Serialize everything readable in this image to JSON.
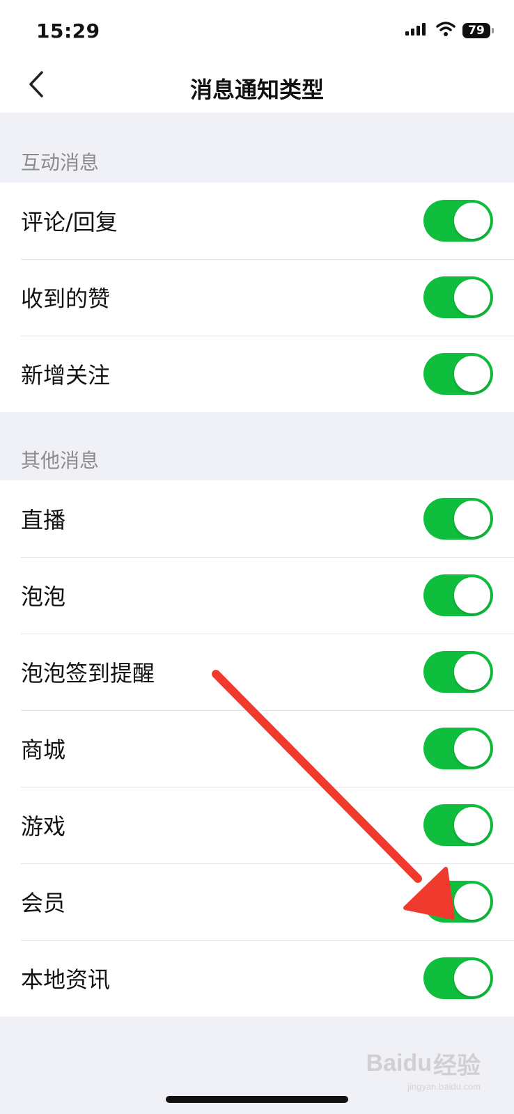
{
  "status_bar": {
    "time": "15:29",
    "battery": "79",
    "icons": [
      "signal-icon",
      "wifi-icon",
      "battery-icon"
    ]
  },
  "header": {
    "title": "消息通知类型",
    "back_icon": "chevron-left-icon"
  },
  "sections": [
    {
      "title": "互动消息",
      "items": [
        {
          "label": "评论/回复",
          "enabled": true
        },
        {
          "label": "收到的赞",
          "enabled": true
        },
        {
          "label": "新增关注",
          "enabled": true
        }
      ]
    },
    {
      "title": "其他消息",
      "items": [
        {
          "label": "直播",
          "enabled": true
        },
        {
          "label": "泡泡",
          "enabled": true
        },
        {
          "label": "泡泡签到提醒",
          "enabled": true
        },
        {
          "label": "商城",
          "enabled": true
        },
        {
          "label": "游戏",
          "enabled": true
        },
        {
          "label": "会员",
          "enabled": true
        },
        {
          "label": "本地资讯",
          "enabled": true
        }
      ]
    }
  ],
  "colors": {
    "toggle_on": "#0fbe3c",
    "background": "#f0f1f6",
    "annotation_arrow": "#f03a2e"
  },
  "watermark": {
    "brand": "Baidu",
    "suffix": "经验",
    "url": "jingyan.baidu.com"
  }
}
